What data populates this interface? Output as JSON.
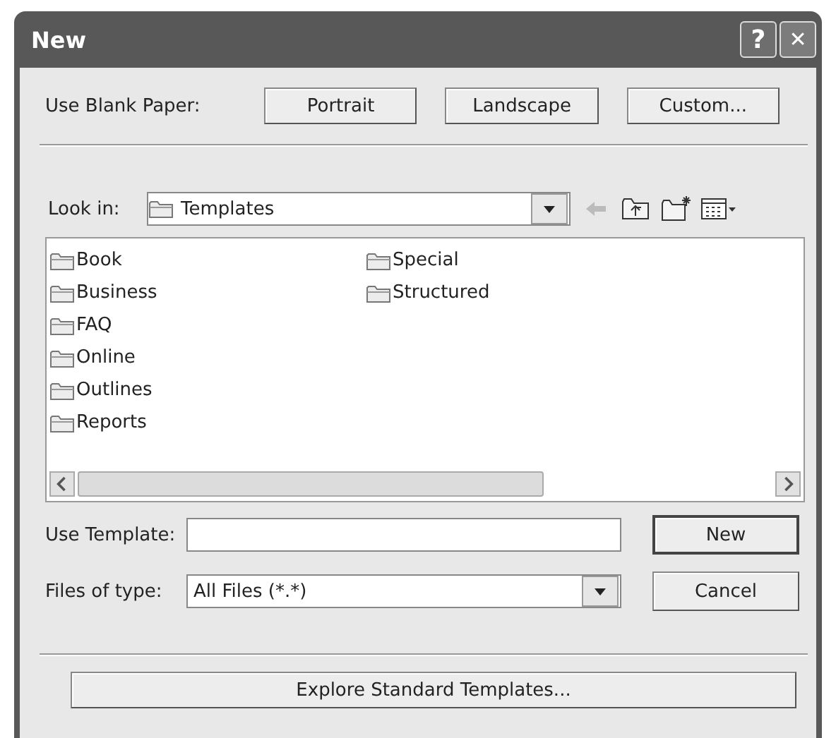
{
  "window": {
    "title": "New",
    "title_buttons": [
      {
        "kind": "help",
        "label": "?"
      },
      {
        "kind": "close",
        "label": "✕"
      }
    ]
  },
  "blank_paper": {
    "label": "Use Blank Paper:",
    "buttons": [
      "Portrait",
      "Landscape",
      "Custom..."
    ]
  },
  "look_in": {
    "label": "Look in:",
    "value": "Templates"
  },
  "files": [
    {
      "name": "Book"
    },
    {
      "name": "Business"
    },
    {
      "name": "FAQ"
    },
    {
      "name": "Online"
    },
    {
      "name": "Outlines"
    },
    {
      "name": "Reports"
    },
    {
      "name": "Special"
    },
    {
      "name": "Structured"
    }
  ],
  "template_field": {
    "label": "Use Template:"
  },
  "file_type": {
    "label": "Files of type:",
    "value": "All Files (*.*)"
  },
  "buttons": [
    {
      "label": "New",
      "selected": true
    },
    {
      "label": "Cancel",
      "selected": false
    }
  ],
  "explore_button": "Explore Standard Templates..."
}
